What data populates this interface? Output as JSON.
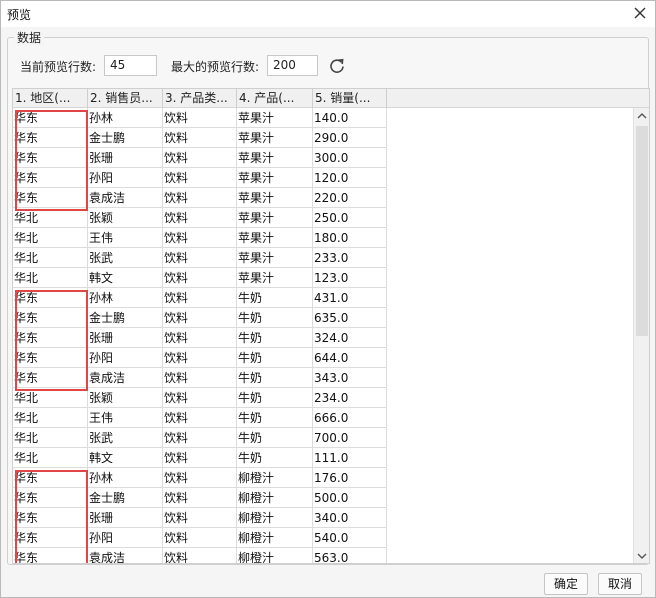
{
  "window": {
    "title": "预览"
  },
  "group": {
    "title": "数据"
  },
  "controls": {
    "current_rows_label": "当前预览行数:",
    "current_rows_value": "45",
    "max_rows_label": "最大的预览行数:",
    "max_rows_value": "200"
  },
  "table": {
    "columns": [
      "1. 地区(...",
      "2. 销售员...",
      "3. 产品类...",
      "4. 产品(...",
      "5. 销量(..."
    ],
    "rows": [
      [
        "华东",
        "孙林",
        "饮料",
        "苹果汁",
        "140.0"
      ],
      [
        "华东",
        "金士鹏",
        "饮料",
        "苹果汁",
        "290.0"
      ],
      [
        "华东",
        "张珊",
        "饮料",
        "苹果汁",
        "300.0"
      ],
      [
        "华东",
        "孙阳",
        "饮料",
        "苹果汁",
        "120.0"
      ],
      [
        "华东",
        "袁成洁",
        "饮料",
        "苹果汁",
        "220.0"
      ],
      [
        "华北",
        "张颖",
        "饮料",
        "苹果汁",
        "250.0"
      ],
      [
        "华北",
        "王伟",
        "饮料",
        "苹果汁",
        "180.0"
      ],
      [
        "华北",
        "张武",
        "饮料",
        "苹果汁",
        "233.0"
      ],
      [
        "华北",
        "韩文",
        "饮料",
        "苹果汁",
        "123.0"
      ],
      [
        "华东",
        "孙林",
        "饮料",
        "牛奶",
        "431.0"
      ],
      [
        "华东",
        "金士鹏",
        "饮料",
        "牛奶",
        "635.0"
      ],
      [
        "华东",
        "张珊",
        "饮料",
        "牛奶",
        "324.0"
      ],
      [
        "华东",
        "孙阳",
        "饮料",
        "牛奶",
        "644.0"
      ],
      [
        "华东",
        "袁成洁",
        "饮料",
        "牛奶",
        "343.0"
      ],
      [
        "华北",
        "张颖",
        "饮料",
        "牛奶",
        "234.0"
      ],
      [
        "华北",
        "王伟",
        "饮料",
        "牛奶",
        "666.0"
      ],
      [
        "华北",
        "张武",
        "饮料",
        "牛奶",
        "700.0"
      ],
      [
        "华北",
        "韩文",
        "饮料",
        "牛奶",
        "111.0"
      ],
      [
        "华东",
        "孙林",
        "饮料",
        "柳橙汁",
        "176.0"
      ],
      [
        "华东",
        "金士鹏",
        "饮料",
        "柳橙汁",
        "500.0"
      ],
      [
        "华东",
        "张珊",
        "饮料",
        "柳橙汁",
        "340.0"
      ],
      [
        "华东",
        "孙阳",
        "饮料",
        "柳橙汁",
        "540.0"
      ],
      [
        "华东",
        "袁成洁",
        "饮料",
        "柳橙汁",
        "563.0"
      ]
    ]
  },
  "highlight_color": "#e04646",
  "footer": {
    "ok_label": "确定",
    "cancel_label": "取消"
  },
  "icons": {
    "close": "close-icon",
    "refresh": "refresh-icon"
  }
}
